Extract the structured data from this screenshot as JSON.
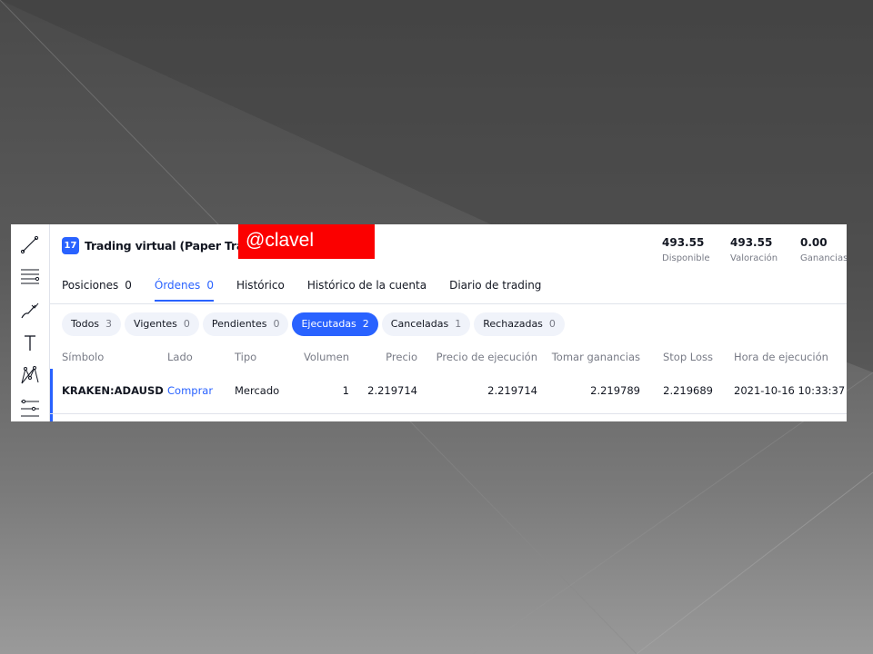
{
  "header": {
    "title": "Trading virtual (Paper Trading)",
    "logo_text": "17",
    "watermark": "@clavel"
  },
  "stats": [
    {
      "value": "493.55",
      "label": "Disponible"
    },
    {
      "value": "493.55",
      "label": "Valoración"
    },
    {
      "value": "0.00",
      "label": "Ganancias a"
    }
  ],
  "tabs": [
    {
      "label": "Posiciones",
      "count": "0"
    },
    {
      "label": "Órdenes",
      "count": "0"
    },
    {
      "label": "Histórico",
      "count": ""
    },
    {
      "label": "Histórico de la cuenta",
      "count": ""
    },
    {
      "label": "Diario de trading",
      "count": ""
    }
  ],
  "active_tab": "Órdenes",
  "filters": [
    {
      "label": "Todos",
      "count": "3"
    },
    {
      "label": "Vigentes",
      "count": "0"
    },
    {
      "label": "Pendientes",
      "count": "0"
    },
    {
      "label": "Ejecutadas",
      "count": "2"
    },
    {
      "label": "Canceladas",
      "count": "1"
    },
    {
      "label": "Rechazadas",
      "count": "0"
    }
  ],
  "active_filter": "Ejecutadas",
  "table": {
    "columns": [
      "Símbolo",
      "Lado",
      "Tipo",
      "Volumen",
      "Precio",
      "Precio de ejecución",
      "Tomar ganancias",
      "Stop Loss",
      "Hora de ejecución"
    ],
    "rows": [
      [
        "KRAKEN:ADAUSD",
        "Comprar",
        "Mercado",
        "1",
        "2.219714",
        "2.219714",
        "2.219789",
        "2.219689",
        "2021-10-16 10:33:37"
      ]
    ]
  },
  "colors": {
    "accent": "#2962ff",
    "watermark_bg": "#fb0000"
  },
  "icons": [
    "trend-line-icon",
    "fib-retracement-icon",
    "brush-icon",
    "text-icon",
    "pattern-icon",
    "prediction-icon"
  ]
}
